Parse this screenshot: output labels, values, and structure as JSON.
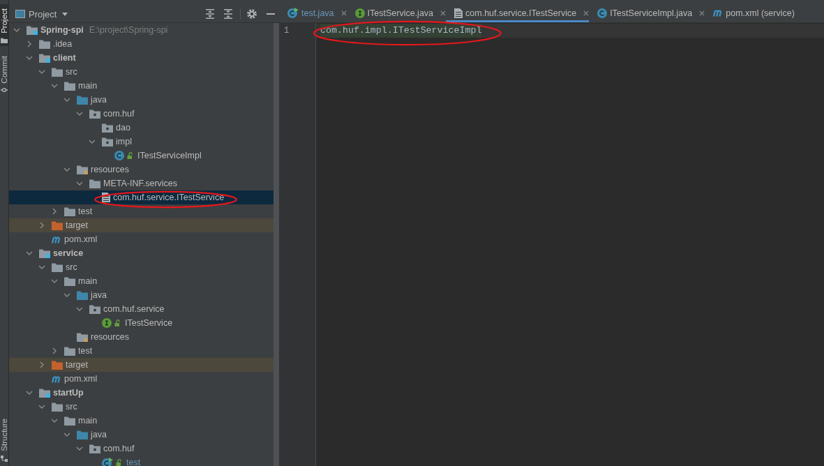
{
  "tool_strip": {
    "top": [
      {
        "label": "Project",
        "kind": "project",
        "selected": true
      },
      {
        "label": "Commit",
        "kind": "commit",
        "selected": false
      }
    ],
    "bottom": [
      {
        "label": "Structure",
        "kind": "structure",
        "selected": false
      }
    ]
  },
  "project_panel": {
    "title": "Project",
    "tree": [
      {
        "label": "Spring-spi",
        "path": "E:\\project\\Spring-spi",
        "kind": "module",
        "expanded": true,
        "selected": false,
        "modified": false,
        "children": [
          {
            "label": ".idea",
            "kind": "folder",
            "expanded": false,
            "selected": false,
            "modified": false
          },
          {
            "label": "client",
            "kind": "module",
            "expanded": true,
            "selected": false,
            "modified": false,
            "children": [
              {
                "label": "src",
                "kind": "folder",
                "expanded": true,
                "selected": false,
                "modified": false,
                "children": [
                  {
                    "label": "main",
                    "kind": "folder",
                    "expanded": true,
                    "selected": false,
                    "modified": false,
                    "children": [
                      {
                        "label": "java",
                        "kind": "source-root",
                        "expanded": true,
                        "selected": false,
                        "modified": false,
                        "children": [
                          {
                            "label": "com.huf",
                            "kind": "package",
                            "expanded": true,
                            "selected": false,
                            "modified": false,
                            "children": [
                              {
                                "label": "dao",
                                "kind": "package",
                                "selected": false,
                                "modified": false
                              },
                              {
                                "label": "impl",
                                "kind": "package",
                                "expanded": true,
                                "selected": false,
                                "modified": false,
                                "children": [
                                  {
                                    "label": "ITestServiceImpl",
                                    "kind": "class",
                                    "selected": false,
                                    "modified": false
                                  }
                                ]
                              }
                            ]
                          }
                        ]
                      },
                      {
                        "label": "resources",
                        "kind": "resources-root",
                        "expanded": true,
                        "selected": false,
                        "modified": false,
                        "children": [
                          {
                            "label": "META-INF.services",
                            "kind": "folder",
                            "expanded": true,
                            "selected": false,
                            "modified": false,
                            "children": [
                              {
                                "label": "com.huf.service.ITestService",
                                "kind": "text-file",
                                "selected": true,
                                "modified": false,
                                "circled": true
                              }
                            ]
                          }
                        ]
                      }
                    ]
                  },
                  {
                    "label": "test",
                    "kind": "folder",
                    "expanded": false,
                    "selected": false,
                    "modified": false
                  }
                ]
              },
              {
                "label": "target",
                "kind": "excluded-folder",
                "expanded": false,
                "selected": false,
                "modified": false
              },
              {
                "label": "pom.xml",
                "kind": "maven",
                "selected": false,
                "modified": false
              }
            ]
          },
          {
            "label": "service",
            "kind": "module",
            "expanded": true,
            "selected": false,
            "modified": false,
            "children": [
              {
                "label": "src",
                "kind": "folder",
                "expanded": true,
                "selected": false,
                "modified": false,
                "children": [
                  {
                    "label": "main",
                    "kind": "folder",
                    "expanded": true,
                    "selected": false,
                    "modified": false,
                    "children": [
                      {
                        "label": "java",
                        "kind": "source-root",
                        "expanded": true,
                        "selected": false,
                        "modified": false,
                        "children": [
                          {
                            "label": "com.huf.service",
                            "kind": "package",
                            "expanded": true,
                            "selected": false,
                            "modified": false,
                            "children": [
                              {
                                "label": "ITestService",
                                "kind": "interface",
                                "selected": false,
                                "modified": false
                              }
                            ]
                          }
                        ]
                      },
                      {
                        "label": "resources",
                        "kind": "resources-root",
                        "selected": false,
                        "modified": false
                      }
                    ]
                  },
                  {
                    "label": "test",
                    "kind": "folder",
                    "expanded": false,
                    "selected": false,
                    "modified": false
                  }
                ]
              },
              {
                "label": "target",
                "kind": "excluded-folder",
                "expanded": false,
                "selected": false,
                "modified": false
              },
              {
                "label": "pom.xml",
                "kind": "maven",
                "selected": false,
                "modified": false
              }
            ]
          },
          {
            "label": "startUp",
            "kind": "module",
            "expanded": true,
            "selected": false,
            "modified": false,
            "children": [
              {
                "label": "src",
                "kind": "folder",
                "expanded": true,
                "selected": false,
                "modified": false,
                "children": [
                  {
                    "label": "main",
                    "kind": "folder",
                    "expanded": true,
                    "selected": false,
                    "modified": false,
                    "children": [
                      {
                        "label": "java",
                        "kind": "source-root",
                        "expanded": true,
                        "selected": false,
                        "modified": false,
                        "children": [
                          {
                            "label": "com.huf",
                            "kind": "package",
                            "expanded": true,
                            "selected": false,
                            "modified": false,
                            "children": [
                              {
                                "label": "test",
                                "kind": "main-class",
                                "selected": false,
                                "modified": true
                              }
                            ]
                          }
                        ]
                      }
                    ]
                  }
                ]
              }
            ]
          }
        ]
      }
    ]
  },
  "editor": {
    "tabs": [
      {
        "label": "test.java",
        "kind": "main-class",
        "selected": false,
        "modified": true,
        "closable": true
      },
      {
        "label": "ITestService.java",
        "kind": "interface",
        "selected": false,
        "modified": false,
        "closable": true
      },
      {
        "label": "com.huf.service.ITestService",
        "kind": "text-file",
        "selected": true,
        "modified": false,
        "closable": true
      },
      {
        "label": "ITestServiceImpl.java",
        "kind": "class",
        "selected": false,
        "modified": false,
        "closable": true
      },
      {
        "label": "pom.xml (service)",
        "kind": "maven",
        "selected": false,
        "modified": false,
        "closable": false
      }
    ],
    "lines": [
      {
        "number": "1",
        "text": "com.huf.impl.ITestServiceImpl",
        "current": true,
        "highlighted": true,
        "circled": true
      }
    ]
  }
}
